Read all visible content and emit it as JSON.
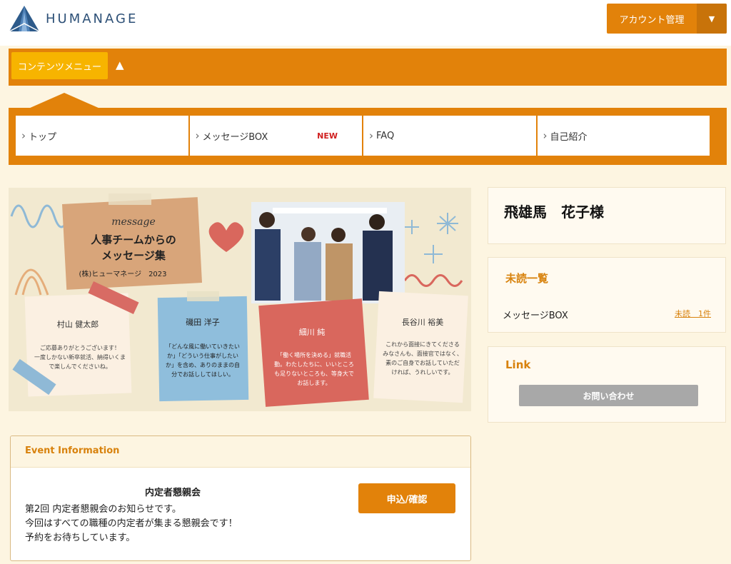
{
  "header": {
    "logo_text": "HUMANAGE",
    "account_label": "アカウント管理",
    "account_caret": "▼"
  },
  "menubar": {
    "menu_label": "コンテンツメニュー",
    "toggle_glyph": "▲"
  },
  "nav": {
    "items": [
      {
        "label": "トップ",
        "badge": ""
      },
      {
        "label": "メッセージBOX",
        "badge": "NEW"
      },
      {
        "label": "FAQ",
        "badge": ""
      },
      {
        "label": "自己紹介",
        "badge": ""
      }
    ],
    "chevron": "›"
  },
  "banner": {
    "message_script": "message",
    "heading_line1": "人事チームからの",
    "heading_line2": "メッセージ集",
    "company": "(株)ヒューマネージ　2023",
    "notes": [
      {
        "name": "村山 健太郎",
        "text_lines": [
          "ご応募ありがとうございます！",
          "一度しかない新卒就活、納得いくま",
          "で楽しんでくださいね。"
        ]
      },
      {
        "name": "磯田 洋子",
        "text_lines": [
          "「どんな風に働いていきたい",
          "か」「どういう仕事がしたい",
          "か」を含め、ありのままの自",
          "分でお話ししてほしい。"
        ]
      },
      {
        "name": "細川 純",
        "text_lines": [
          "「働く場所を決める」就職活",
          "動。わたしたちに、いいところ",
          "も足りないところも、等身大で",
          "お話します。"
        ]
      },
      {
        "name": "長谷川 裕美",
        "text_lines": [
          "これから面接にきてくださる",
          "みなさんも、面接官ではなく、",
          "素のご自身でお話していただ",
          "ければ、うれしいです。"
        ]
      }
    ]
  },
  "sidebar": {
    "user_name": "飛雄馬　花子様",
    "unread_title": "未読一覧",
    "unread_label": "メッセージBOX",
    "unread_count": "未読　1件",
    "link_title": "Link",
    "contact_label": "お問い合わせ"
  },
  "event": {
    "section_title": "Event Information",
    "title": "内定者懇親会",
    "line1": "第2回 内定者懇親会のお知らせです。",
    "line2": "今回はすべての職種の内定者が集まる懇親会です！",
    "line3": "予約をお待ちしています。",
    "apply_label": "申込/確認"
  },
  "colors": {
    "accent_orange": "#e2820a",
    "menu_yellow": "#f7b400",
    "page_bg": "#fdf5e1",
    "heading_orange": "#d8820d",
    "new_badge": "#d02020",
    "contact_gray": "#a8a8a8",
    "logo_blue": "#2d5077"
  },
  "icons": {
    "logo": "triangle-mountain-logo-icon",
    "caret": "caret-down-icon",
    "menu_toggle": "triangle-up-icon",
    "nav_chevron": "chevron-right-icon"
  }
}
